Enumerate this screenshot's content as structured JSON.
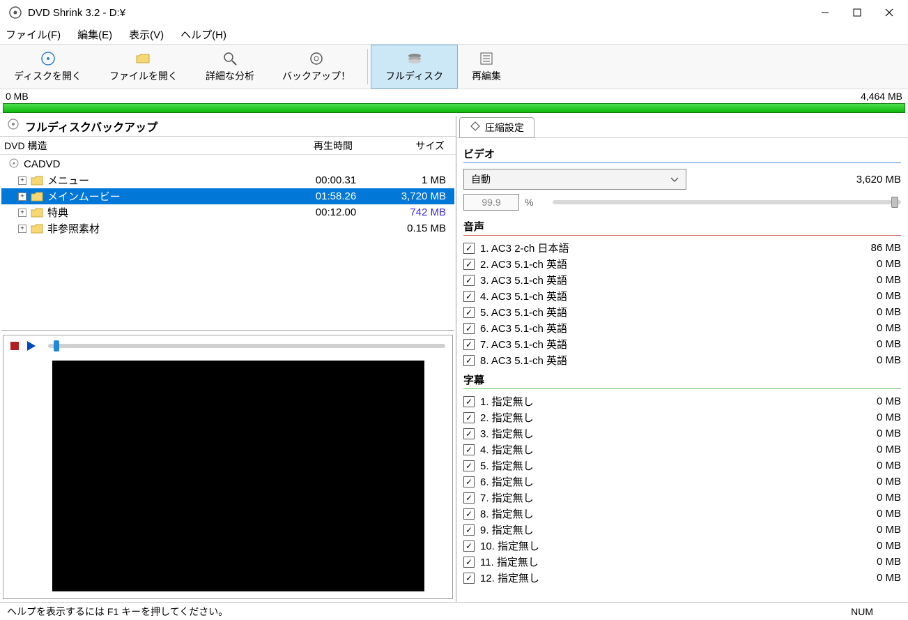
{
  "window": {
    "title": "DVD Shrink 3.2 - D:¥"
  },
  "menubar": {
    "file": "ファイル(F)",
    "edit": "編集(E)",
    "view": "表示(V)",
    "help": "ヘルプ(H)"
  },
  "toolbar": {
    "open_disc": "ディスクを開く",
    "open_file": "ファイルを開く",
    "analyze": "詳細な分析",
    "backup": "バックアップ！",
    "full_disc": "フルディスク",
    "reauthor": "再編集"
  },
  "sizebar": {
    "left": "0 MB",
    "right": "4,464 MB"
  },
  "left": {
    "header": "フルディスクバックアップ",
    "columns": {
      "structure": "DVD 構造",
      "duration": "再生時間",
      "size": "サイズ"
    },
    "root": "CADVD",
    "items": [
      {
        "name": "メニュー",
        "duration": "00:00.31",
        "size": "1 MB",
        "selected": false,
        "purple": false
      },
      {
        "name": "メインムービー",
        "duration": "01:58.26",
        "size": "3,720 MB",
        "selected": true,
        "purple": false
      },
      {
        "name": "特典",
        "duration": "00:12.00",
        "size": "742 MB",
        "selected": false,
        "purple": true
      },
      {
        "name": "非参照素材",
        "duration": "",
        "size": "0.15 MB",
        "selected": false,
        "purple": false
      }
    ]
  },
  "right": {
    "tab": "圧縮設定",
    "video": {
      "title": "ビデオ",
      "dropdown": "自動",
      "size": "3,620 MB",
      "ratio_input": "99.9",
      "pct": "%"
    },
    "audio": {
      "title": "音声",
      "items": [
        {
          "label": "1. AC3 2-ch 日本語",
          "size": "86 MB"
        },
        {
          "label": "2. AC3 5.1-ch 英語",
          "size": "0 MB"
        },
        {
          "label": "3. AC3 5.1-ch 英語",
          "size": "0 MB"
        },
        {
          "label": "4. AC3 5.1-ch 英語",
          "size": "0 MB"
        },
        {
          "label": "5. AC3 5.1-ch 英語",
          "size": "0 MB"
        },
        {
          "label": "6. AC3 5.1-ch 英語",
          "size": "0 MB"
        },
        {
          "label": "7. AC3 5.1-ch 英語",
          "size": "0 MB"
        },
        {
          "label": "8. AC3 5.1-ch 英語",
          "size": "0 MB"
        }
      ]
    },
    "subtitle": {
      "title": "字幕",
      "items": [
        {
          "label": "1. 指定無し",
          "size": "0 MB"
        },
        {
          "label": "2. 指定無し",
          "size": "0 MB"
        },
        {
          "label": "3. 指定無し",
          "size": "0 MB"
        },
        {
          "label": "4. 指定無し",
          "size": "0 MB"
        },
        {
          "label": "5. 指定無し",
          "size": "0 MB"
        },
        {
          "label": "6. 指定無し",
          "size": "0 MB"
        },
        {
          "label": "7. 指定無し",
          "size": "0 MB"
        },
        {
          "label": "8. 指定無し",
          "size": "0 MB"
        },
        {
          "label": "9. 指定無し",
          "size": "0 MB"
        },
        {
          "label": "10. 指定無し",
          "size": "0 MB"
        },
        {
          "label": "11. 指定無し",
          "size": "0 MB"
        },
        {
          "label": "12. 指定無し",
          "size": "0 MB"
        }
      ]
    }
  },
  "statusbar": {
    "help": "ヘルプを表示するには F1 キーを押してください。",
    "num": "NUM"
  }
}
